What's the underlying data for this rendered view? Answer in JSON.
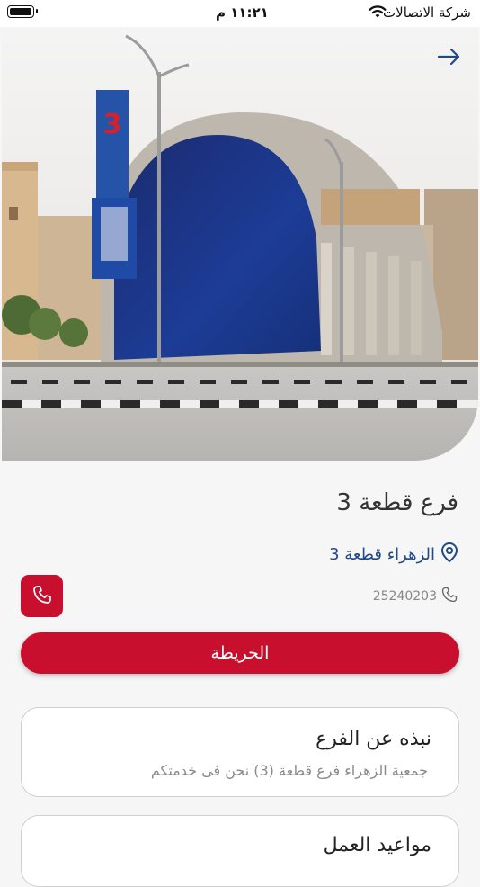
{
  "status_bar": {
    "carrier": "شركة الاتصالات",
    "time": "١١:٢١ م"
  },
  "branch": {
    "name": "فرع قطعة 3",
    "location": "الزهراء قطعة 3",
    "phone": "25240203"
  },
  "actions": {
    "map_label": "الخريطة"
  },
  "about": {
    "title": "نبذه عن الفرع",
    "body": "جمعية الزهراء فرع قطعة (3) نحن فى خدمتكم"
  },
  "hours": {
    "title": "مواعيد العمل"
  },
  "hero_image": {
    "sign_text": "3"
  },
  "colors": {
    "accent": "#c8102e",
    "link": "#1e4a86",
    "background": "#f6f6f6"
  },
  "icons": [
    "back-arrow-icon",
    "location-pin-icon",
    "phone-icon",
    "wifi-icon",
    "battery-icon"
  ]
}
